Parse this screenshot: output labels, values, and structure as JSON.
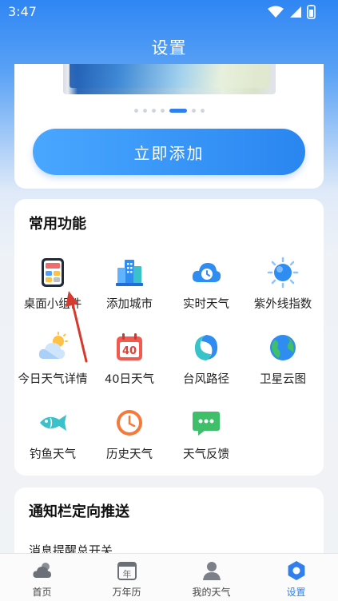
{
  "status_bar": {
    "time": "3:47"
  },
  "header": {
    "title": "设置"
  },
  "promo": {
    "add_button_label": "立即添加",
    "page_count": 7,
    "active_page": 5
  },
  "common_functions": {
    "title": "常用功能",
    "items": [
      {
        "label": "桌面小组件",
        "icon": "widget-icon"
      },
      {
        "label": "添加城市",
        "icon": "city-buildings-icon"
      },
      {
        "label": "实时天气",
        "icon": "cloud-clock-icon"
      },
      {
        "label": "紫外线指数",
        "icon": "sun-uv-icon"
      },
      {
        "label": "今日天气详情",
        "icon": "sun-cloud-icon"
      },
      {
        "label": "40日天气",
        "icon": "calendar-40-icon"
      },
      {
        "label": "台风路径",
        "icon": "typhoon-icon"
      },
      {
        "label": "卫星云图",
        "icon": "globe-icon"
      },
      {
        "label": "钓鱼天气",
        "icon": "fish-icon"
      },
      {
        "label": "历史天气",
        "icon": "history-clock-icon"
      },
      {
        "label": "天气反馈",
        "icon": "chat-feedback-icon"
      }
    ]
  },
  "push_section": {
    "title": "通知栏定向推送",
    "row_label": "消息提醒总开关"
  },
  "tab_bar": {
    "tabs": [
      {
        "label": "首页",
        "icon": "weather-home-icon"
      },
      {
        "label": "万年历",
        "icon": "calendar-icon",
        "icon_text": "年"
      },
      {
        "label": "我的天气",
        "icon": "person-icon"
      },
      {
        "label": "设置",
        "icon": "settings-hexagon-icon"
      }
    ],
    "active_index": 3
  },
  "colors": {
    "accent": "#2f80ed",
    "header_blue": "#2f86f3"
  }
}
